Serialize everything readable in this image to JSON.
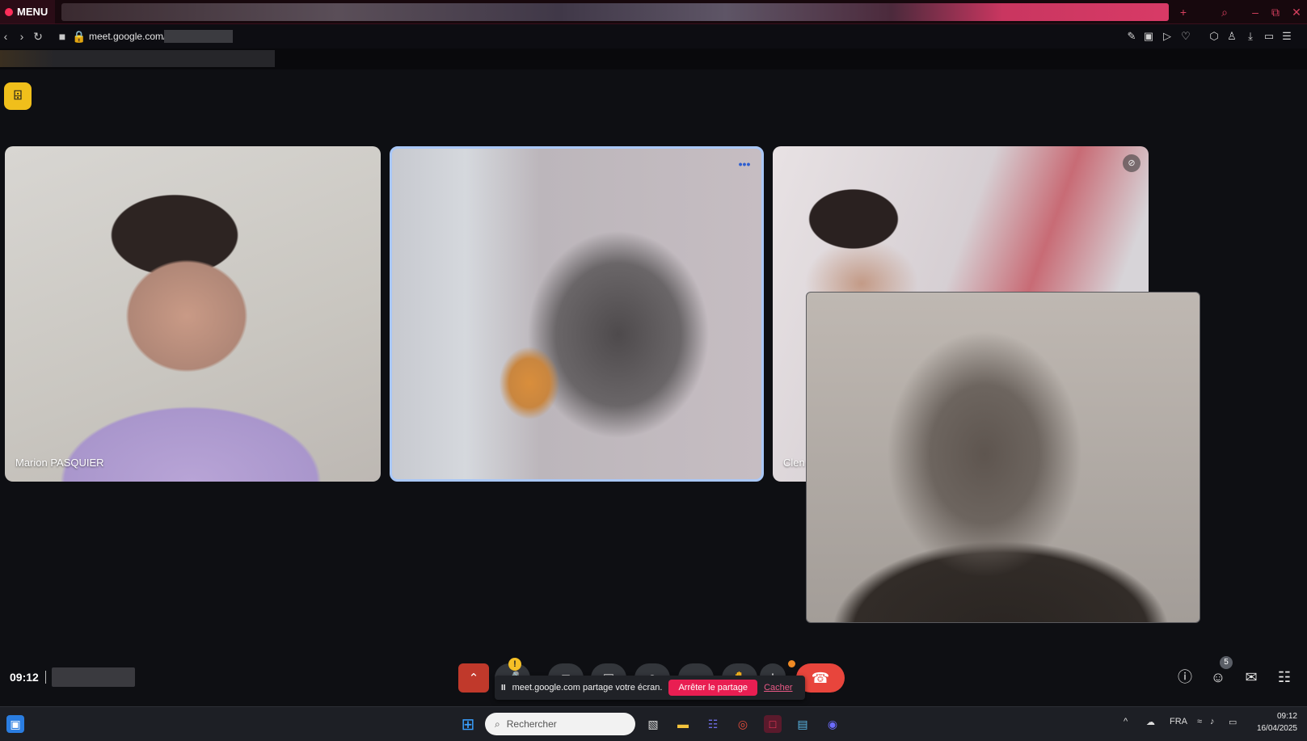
{
  "browser": {
    "menu_label": "MENU",
    "url_text": "meet.google.com/"
  },
  "meet": {
    "badge_glyph": "⌹",
    "participants": [
      {
        "name": "Marion PASQUIER"
      },
      {
        "name": ""
      },
      {
        "name": "Clen"
      }
    ],
    "more_glyph": "•••",
    "muted_glyph": "⊘",
    "time": "09:12",
    "controls": {
      "chevron": "⌃",
      "hangup": "☎"
    },
    "warn_glyph": "!",
    "share_bar": {
      "pause_glyph": "II",
      "message": "meet.google.com partage votre écran.",
      "stop_label": "Arrêter le partage",
      "hide_label": "Cacher"
    },
    "people_count": "5",
    "right_icons": {
      "info": "ⓘ",
      "people": "☺",
      "chat": "✉",
      "apps": "☷"
    }
  },
  "taskbar": {
    "search_placeholder": "Rechercher",
    "search_glyph": "⌕",
    "language": "FRA",
    "clock_time": "09:12",
    "clock_date": "16/04/2025",
    "tray_chevron": "^",
    "tray_net": "☁",
    "tray_wifi": "≈",
    "tray_vol": "♪",
    "tray_batt": "▭"
  },
  "colors": {
    "accent": "#e91e52",
    "meet_bg": "#0e0f13",
    "speaker_border": "#a9c7f7",
    "hangup": "#e8453c"
  },
  "icons": {
    "toolbar": [
      "back-icon",
      "forward-icon",
      "reload-icon",
      "camera-icon",
      "lock-icon"
    ],
    "extensions": [
      "edit-icon",
      "screenshot-icon",
      "play-icon",
      "heart-icon",
      "cube-icon",
      "account-icon",
      "download-icon",
      "battery-icon",
      "menu-lines-icon"
    ]
  }
}
